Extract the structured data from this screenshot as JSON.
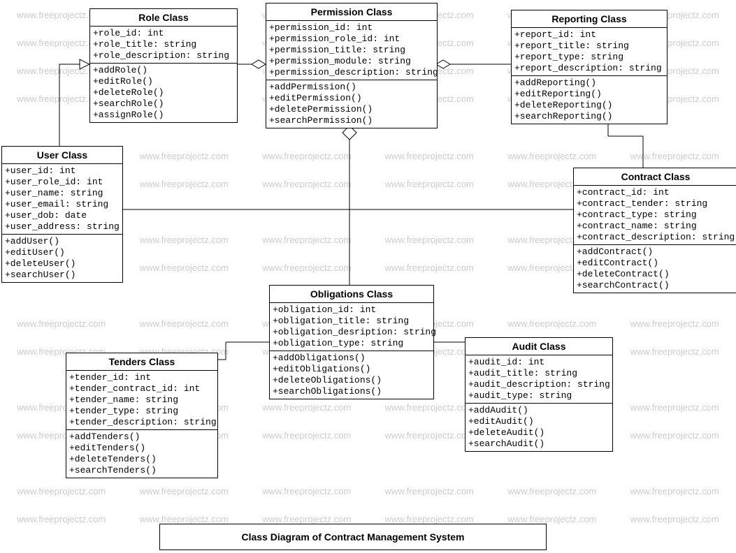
{
  "watermark": "www.freeprojectz.com",
  "diagram_title": "Class Diagram of Contract Management System",
  "classes": {
    "role": {
      "title": "Role Class",
      "attrs": [
        "+role_id: int",
        "+role_title: string",
        "+role_description: string"
      ],
      "ops": [
        "+addRole()",
        "+editRole()",
        "+deleteRole()",
        "+searchRole()",
        "+assignRole()"
      ]
    },
    "permission": {
      "title": "Permission Class",
      "attrs": [
        "+permission_id: int",
        "+permission_role_id: int",
        "+permission_title: string",
        "+permission_module: string",
        "+permission_description: string"
      ],
      "ops": [
        "+addPermission()",
        "+editPermission()",
        "+deletePermission()",
        "+searchPermission()"
      ]
    },
    "reporting": {
      "title": "Reporting Class",
      "attrs": [
        "+report_id: int",
        "+report_title: string",
        "+report_type: string",
        "+report_description: string"
      ],
      "ops": [
        "+addReporting()",
        "+editReporting()",
        "+deleteReporting()",
        "+searchReporting()"
      ]
    },
    "user": {
      "title": "User Class",
      "attrs": [
        "+user_id: int",
        "+user_role_id: int",
        "+user_name: string",
        "+user_email: string",
        "+user_dob: date",
        "+user_address: string"
      ],
      "ops": [
        "+addUser()",
        "+editUser()",
        "+deleteUser()",
        "+searchUser()"
      ]
    },
    "contract": {
      "title": "Contract Class",
      "attrs": [
        "+contract_id: int",
        "+contract_tender: string",
        "+contract_type: string",
        "+contract_name: string",
        "+contract_description: string"
      ],
      "ops": [
        "+addContract()",
        "+editContract()",
        "+deleteContract()",
        "+searchContract()"
      ]
    },
    "obligations": {
      "title": "Obligations Class",
      "attrs": [
        "+obligation_id: int",
        "+obligation_title: string",
        "+obligation_desription: string",
        "+obligation_type: string"
      ],
      "ops": [
        "+addObligations()",
        "+editObligations()",
        "+deleteObligations()",
        "+searchObligations()"
      ]
    },
    "tenders": {
      "title": "Tenders Class",
      "attrs": [
        "+tender_id: int",
        "+tender_contract_id: int",
        "+tender_name: string",
        "+tender_type: string",
        "+tender_description: string"
      ],
      "ops": [
        "+addTenders()",
        "+editTenders()",
        "+deleteTenders()",
        "+searchTenders()"
      ]
    },
    "audit": {
      "title": "Audit Class",
      "attrs": [
        "+audit_id: int",
        "+audit_title: string",
        "+audit_description: string",
        "+audit_type: string"
      ],
      "ops": [
        "+addAudit()",
        "+editAudit()",
        "+deleteAudit()",
        "+searchAudit()"
      ]
    }
  }
}
